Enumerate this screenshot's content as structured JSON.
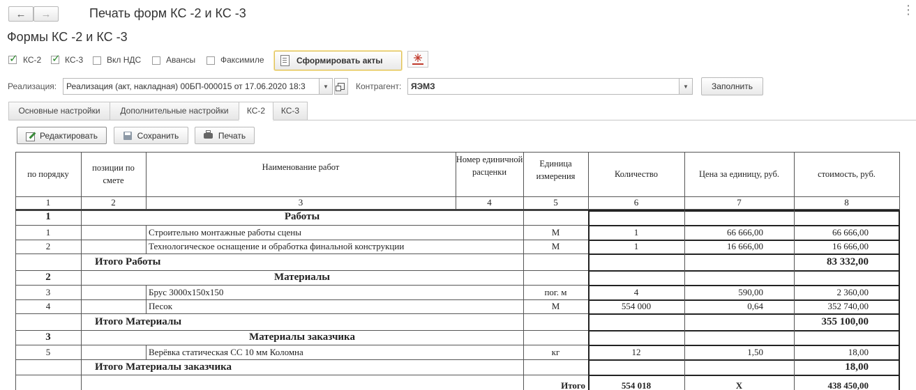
{
  "window": {
    "title": "Печать форм КС -2 и КС -3"
  },
  "form": {
    "title": "Формы КС -2 и КС -3"
  },
  "options": [
    {
      "label": "КС-2",
      "checked": true
    },
    {
      "label": "КС-3",
      "checked": true
    },
    {
      "label": "Вкл НДС",
      "checked": false
    },
    {
      "label": "Авансы",
      "checked": false
    },
    {
      "label": "Факсимиле",
      "checked": false
    }
  ],
  "toolbar": {
    "generate_label": "Сформировать акты"
  },
  "realization": {
    "label": "Реализация:",
    "value": "Реализация (акт, накладная) 00БП-000015 от 17.06.2020 18:3"
  },
  "contractor": {
    "label": "Контрагент:",
    "value": "ЯЭМЗ"
  },
  "fill_label": "Заполнить",
  "tabs": [
    {
      "label": "Основные настройки"
    },
    {
      "label": "Дополнительные настройки"
    },
    {
      "label": "КС-2"
    },
    {
      "label": "КС-3"
    }
  ],
  "actions": {
    "edit_label": "Редактировать",
    "save_label": "Сохранить",
    "print_label": "Печать"
  },
  "table": {
    "headers": [
      "по порядку",
      "позиции по смете",
      "Наименование работ",
      "Номер единичной расценки",
      "Единица измерения",
      "Количество",
      "Цена за единицу, руб.",
      "стоимость, руб."
    ],
    "col_numbers": [
      "1",
      "2",
      "3",
      "4",
      "5",
      "6",
      "7",
      "8"
    ],
    "rows": [
      {
        "kind": "section",
        "num": "1",
        "name": "Работы"
      },
      {
        "kind": "item",
        "num": "1",
        "name": "Строительно монтажные работы сцены",
        "unit": "М",
        "qty": "1",
        "price": "66 666,00",
        "cost": "66 666,00"
      },
      {
        "kind": "item",
        "num": "2",
        "name": "Технологическое оснащение и обработка финальной конструкции",
        "unit": "М",
        "qty": "1",
        "price": "16 666,00",
        "cost": "16 666,00"
      },
      {
        "kind": "total",
        "name": "Итого Работы",
        "cost": "83 332,00"
      },
      {
        "kind": "section",
        "num": "2",
        "name": "Материалы"
      },
      {
        "kind": "item",
        "num": "3",
        "name": "Брус 3000х150х150",
        "unit": "пог. м",
        "qty": "4",
        "price": "590,00",
        "cost": "2 360,00"
      },
      {
        "kind": "item",
        "num": "4",
        "name": "Песок",
        "unit": "М",
        "qty": "554 000",
        "price": "0,64",
        "cost": "352 740,00"
      },
      {
        "kind": "total",
        "name": "Итого Материалы",
        "cost": "355 100,00"
      },
      {
        "kind": "section",
        "num": "3",
        "name": "Материалы заказчика"
      },
      {
        "kind": "item",
        "num": "5",
        "name": "Верёвка статическая СС 10 мм Коломна",
        "unit": "кг",
        "qty": "12",
        "price": "1,50",
        "cost": "18,00"
      },
      {
        "kind": "total",
        "name": "Итого Материалы заказчика",
        "cost": "18,00"
      }
    ],
    "grand": {
      "label": "Итого",
      "qty": "554 018",
      "price": "Х",
      "cost": "438 450,00"
    }
  }
}
